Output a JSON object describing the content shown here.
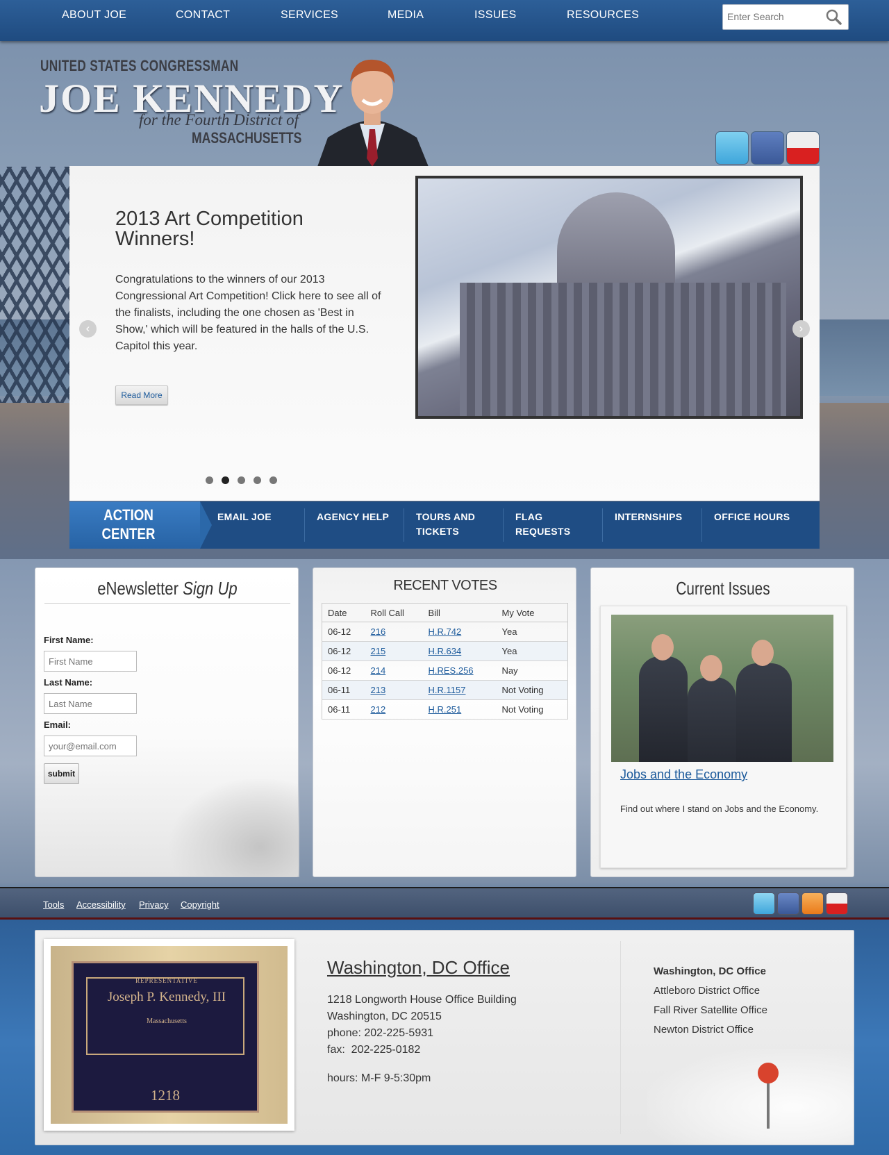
{
  "nav": {
    "items": [
      "ABOUT JOE",
      "CONTACT",
      "SERVICES",
      "MEDIA",
      "ISSUES",
      "RESOURCES"
    ],
    "search_placeholder": "Enter Search"
  },
  "header": {
    "pre": "UNITED STATES CONGRESSMAN",
    "name": "JOE KENNEDY",
    "sub": "for the Fourth District of",
    "state": "MASSACHUSETTS",
    "social": [
      "twitter-icon",
      "facebook-icon",
      "youtube-icon"
    ]
  },
  "slider": {
    "title": "2013 Art Competition Winners!",
    "text": "Congratulations to the winners of our 2013 Congressional Art Competition! Click here to see all of the finalists, including the one chosen as 'Best in Show,' which will be featured in the halls of the U.S. Capitol this year.",
    "read_more": "Read More",
    "prev": "‹",
    "next": "›",
    "dots": 5,
    "active_dot": 2
  },
  "action_center": {
    "label": "ACTION CENTER",
    "items": [
      "EMAIL JOE",
      "AGENCY HELP",
      "TOURS AND TICKETS",
      "FLAG REQUESTS",
      "INTERNSHIPS",
      "OFFICE HOURS"
    ]
  },
  "newsletter": {
    "title_a": "eNewsletter",
    "title_b": "Sign Up",
    "first_label": "First Name:",
    "first_placeholder": "First Name",
    "last_label": "Last Name:",
    "last_placeholder": "Last Name",
    "email_label": "Email:",
    "email_placeholder": "your@email.com",
    "submit": "submit"
  },
  "votes": {
    "title": "RECENT VOTES",
    "headers": [
      "Date",
      "Roll Call",
      "Bill",
      "My Vote"
    ],
    "rows": [
      [
        "06-12",
        "216",
        "H.R.742",
        "Yea"
      ],
      [
        "06-12",
        "215",
        "H.R.634",
        "Yea"
      ],
      [
        "06-12",
        "214",
        "H.RES.256",
        "Nay"
      ],
      [
        "06-11",
        "213",
        "H.R.1157",
        "Not Voting"
      ],
      [
        "06-11",
        "212",
        "H.R.251",
        "Not Voting"
      ]
    ]
  },
  "issues": {
    "title": "Current Issues",
    "link": "Jobs and the Economy",
    "text": "Find out where I stand on Jobs and the Economy."
  },
  "footer": {
    "links": [
      "Tools",
      "Accessibility",
      "Privacy",
      "Copyright"
    ],
    "social": [
      "twitter-icon",
      "facebook-icon",
      "rss-icon",
      "youtube-icon"
    ]
  },
  "office": {
    "plaque_l1": "REPRESENTATIVE",
    "plaque_l2": "Joseph P. Kennedy, III",
    "plaque_l3": "Massachusetts",
    "plaque_room": "1218",
    "title": "Washington, DC Office",
    "address_1": "1218 Longworth House Office Building",
    "address_2": "Washington, DC 20515",
    "phone": "phone: 202-225-5931",
    "fax": "fax:  202-225-0182",
    "hours": "hours: M-F 9-5:30pm",
    "list": [
      "Washington, DC Office",
      "Attleboro District Office",
      "Fall River Satellite Office",
      "Newton District Office"
    ]
  },
  "colors": {
    "nav_blue": "#1f4b80",
    "link": "#1c5a9b",
    "action_tab": "#2d6bb0"
  }
}
